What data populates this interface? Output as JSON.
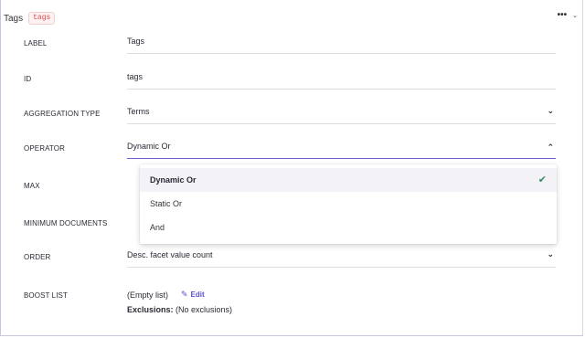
{
  "header": {
    "title": "Tags",
    "badge": "tags",
    "more_icon": "more-horizontal-icon",
    "collapse_icon": "chevron-down-icon"
  },
  "rows": {
    "label": {
      "label": "LABEL",
      "value": "Tags"
    },
    "id": {
      "label": "ID",
      "value": "tags"
    },
    "aggregation_type": {
      "label": "AGGREGATION TYPE",
      "value": "Terms"
    },
    "operator": {
      "label": "OPERATOR",
      "value": "Dynamic Or"
    },
    "max": {
      "label": "MAX"
    },
    "minimum_documents": {
      "label": "MINIMUM DOCUMENTS"
    },
    "order": {
      "label": "ORDER",
      "value": "Desc. facet value count"
    },
    "boost_list": {
      "label": "BOOST LIST",
      "value": "(Empty list)",
      "edit_label": "Edit",
      "exclusions_label": "Exclusions:",
      "exclusions_value": "(No exclusions)"
    }
  },
  "operator_dropdown": {
    "options": [
      "Dynamic Or",
      "Static Or",
      "And"
    ],
    "selected": "Dynamic Or"
  },
  "colors": {
    "accent": "#6a5bd6",
    "check": "#3b8a6a",
    "badge_text": "#d8464a"
  }
}
